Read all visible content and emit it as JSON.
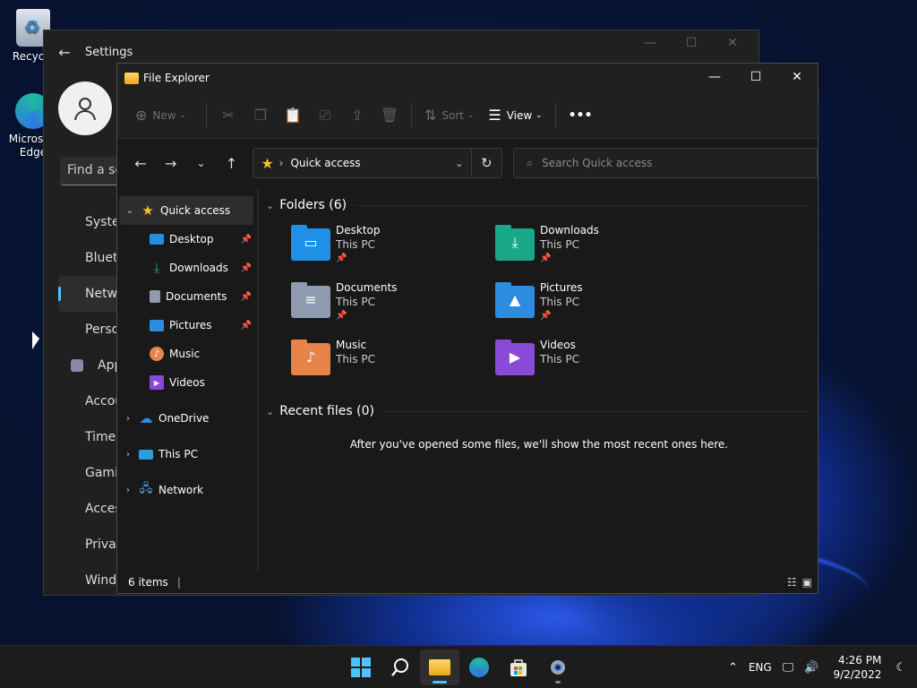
{
  "desktop": {
    "icons": [
      {
        "label": "Recycle"
      },
      {
        "label": "Microsoft Edge"
      }
    ]
  },
  "settings": {
    "title": "Settings",
    "search_placeholder": "Find a setting",
    "nav": [
      {
        "label": "System",
        "color": "#4cc2ff"
      },
      {
        "label": "Bluetooth & devices",
        "color": "#2d7be0"
      },
      {
        "label": "Network & internet",
        "color": "#6fb5ff"
      },
      {
        "label": "Personalization",
        "color": "#e0a050"
      },
      {
        "label": "Apps",
        "color": "#8a8aa8"
      },
      {
        "label": "Accounts",
        "color": "#36c08a"
      },
      {
        "label": "Time & language",
        "color": "#2d9be0"
      },
      {
        "label": "Gaming",
        "color": "#9a9a9a"
      },
      {
        "label": "Accessibility",
        "color": "#4c8cff"
      },
      {
        "label": "Privacy & security",
        "color": "#9a9a9a"
      },
      {
        "label": "Windows Update",
        "color": "#2d9be0"
      }
    ]
  },
  "explorer": {
    "title": "File Explorer",
    "cmd": {
      "new": "New",
      "sort": "Sort",
      "view": "View",
      "more": "•••"
    },
    "address": "Quick access",
    "search_placeholder": "Search Quick access",
    "sidebar": {
      "quick_access": "Quick access",
      "pinned": [
        {
          "label": "Desktop",
          "pinned": true
        },
        {
          "label": "Downloads",
          "pinned": true
        },
        {
          "label": "Documents",
          "pinned": true
        },
        {
          "label": "Pictures",
          "pinned": true
        },
        {
          "label": "Music",
          "pinned": false
        },
        {
          "label": "Videos",
          "pinned": false
        }
      ],
      "roots": [
        "OneDrive",
        "This PC",
        "Network"
      ]
    },
    "folders_header": "Folders (6)",
    "folders": [
      {
        "name": "Desktop",
        "location": "This PC",
        "pinned": true,
        "color": "#1e90e8",
        "glyph": "▭"
      },
      {
        "name": "Downloads",
        "location": "This PC",
        "pinned": true,
        "color": "#1aa88a",
        "glyph": "⤓"
      },
      {
        "name": "Documents",
        "location": "This PC",
        "pinned": true,
        "color": "#8f9bb0",
        "glyph": "≡"
      },
      {
        "name": "Pictures",
        "location": "This PC",
        "pinned": true,
        "color": "#2d8be0",
        "glyph": "▲"
      },
      {
        "name": "Music",
        "location": "This PC",
        "pinned": false,
        "color": "#e8844a",
        "glyph": "♪"
      },
      {
        "name": "Videos",
        "location": "This PC",
        "pinned": false,
        "color": "#8a4ad8",
        "glyph": "▶"
      }
    ],
    "recent_header": "Recent files (0)",
    "recent_message": "After you've opened some files, we'll show the most recent ones here.",
    "status": "6 items"
  },
  "taskbar": {
    "lang": "ENG",
    "time": "4:26 PM",
    "date": "9/2/2022"
  }
}
